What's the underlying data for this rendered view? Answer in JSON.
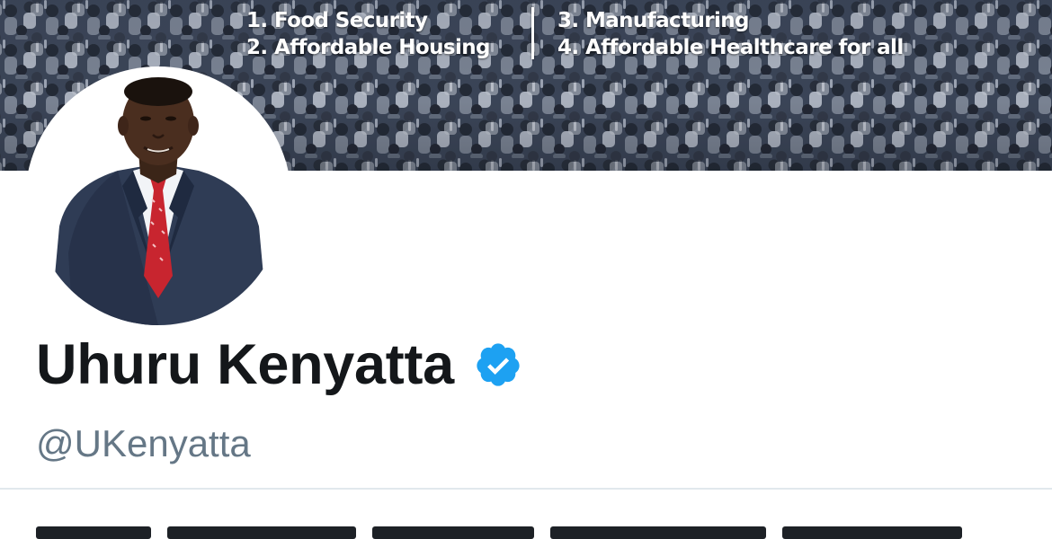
{
  "banner": {
    "agenda_left": [
      "1. Food Security",
      "2. Affordable Housing"
    ],
    "agenda_right": [
      "3. Manufacturing",
      "4. Affordable Healthcare for all"
    ]
  },
  "profile": {
    "display_name": "Uhuru Kenyatta",
    "handle": "@UKenyatta",
    "verified": true
  },
  "colors": {
    "verified_badge": "#1da1f2",
    "name_text": "#14171a",
    "handle_text": "#657786",
    "divider": "#e1e8ed"
  },
  "icons": {
    "verified": "verified-badge-icon"
  }
}
